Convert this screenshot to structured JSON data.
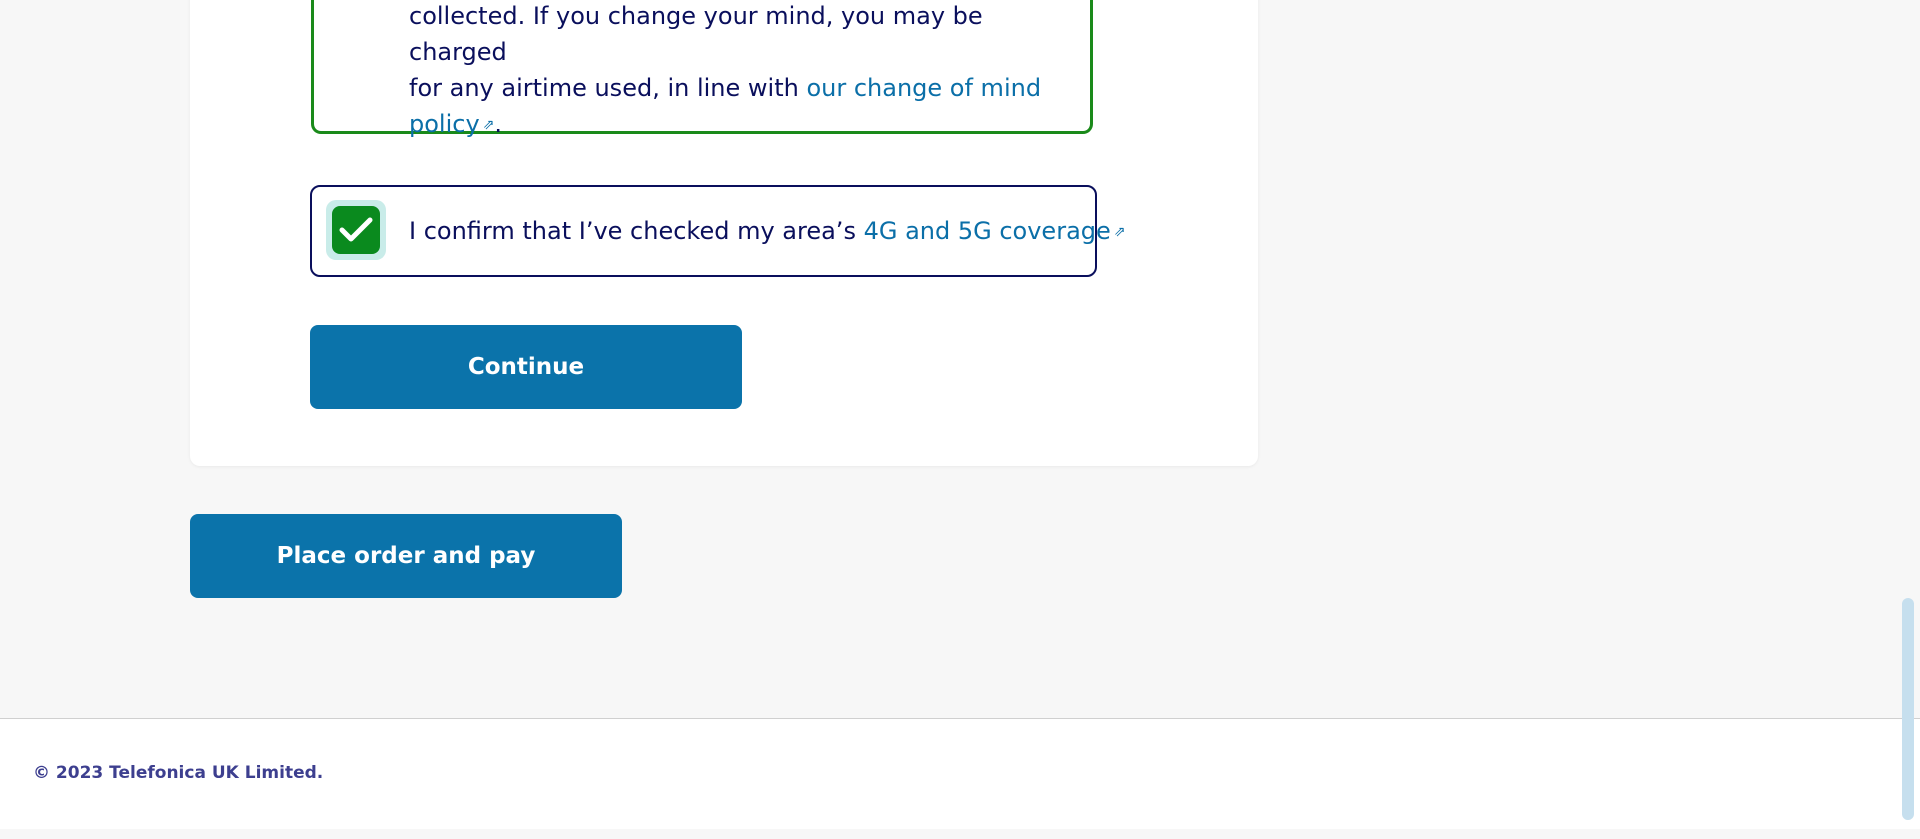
{
  "policy": {
    "line1": "collected. If you change your mind, you may be charged",
    "line2_text": "for any airtime used, in line with ",
    "link_text": "our change of mind",
    "link_text2": "policy",
    "trailing": "."
  },
  "confirm": {
    "text": "I confirm that I’ve checked my area’s ",
    "link_text": "4G and 5G coverage",
    "checked": true
  },
  "buttons": {
    "continue_label": "Continue",
    "place_order_label": "Place order and pay"
  },
  "footer": {
    "copyright": "© 2023 Telefonica UK Limited."
  },
  "colors": {
    "brand_blue": "#0b73aa",
    "link_blue": "#0b6fa8",
    "navy_text": "#0a0f5c",
    "success_green": "#0a8a1e"
  },
  "icons": {
    "external_link": "external-link-icon",
    "checkmark": "checkmark-icon"
  }
}
